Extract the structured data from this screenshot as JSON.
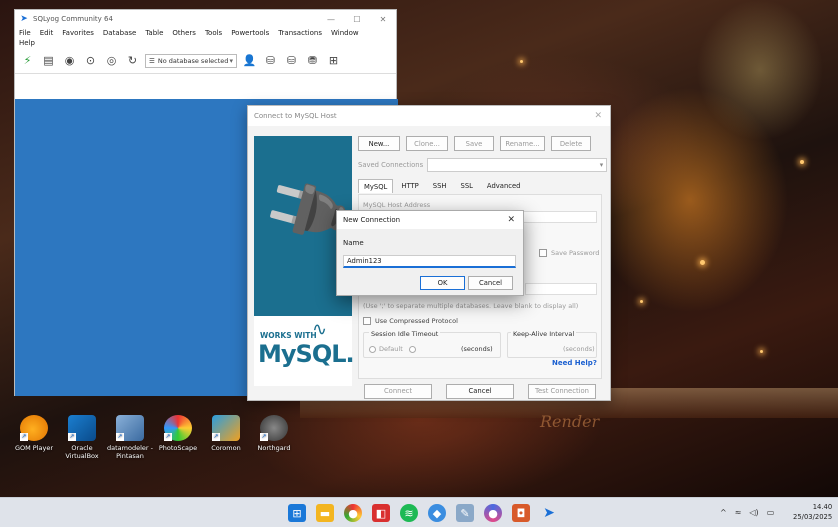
{
  "sqlyog": {
    "title": "SQLyog Community 64",
    "menu": [
      "File",
      "Edit",
      "Favorites",
      "Database",
      "Table",
      "Others",
      "Tools",
      "Powertools",
      "Transactions",
      "Window",
      "Help"
    ],
    "db_select": "No database selected"
  },
  "connect": {
    "title": "Connect to MySQL Host",
    "buttons": {
      "new": "New...",
      "clone": "Clone...",
      "save": "Save",
      "rename": "Rename...",
      "delete": "Delete"
    },
    "saved_connections_label": "Saved Connections",
    "tabs": [
      "MySQL",
      "HTTP",
      "SSH",
      "SSL",
      "Advanced"
    ],
    "mysql_host_label": "MySQL Host Address",
    "save_password_label": "Save Password",
    "databases_hint": "(Use ';' to separate multiple databases. Leave blank to display all)",
    "compressed_label": "Use Compressed Protocol",
    "session_label": "Session Idle Timeout",
    "default_label": "Default",
    "seconds_label": "(seconds)",
    "keepalive_label": "Keep-Alive Interval",
    "keepalive_seconds": "(seconds)",
    "need_help": "Need Help?",
    "connect_btn": "Connect",
    "cancel_btn": "Cancel",
    "test_btn": "Test Connection",
    "brand_works": "WORKS WITH",
    "brand_mysql": "MySQL."
  },
  "newconn": {
    "title": "New Connection",
    "name_label": "Name",
    "name_value": "Admin123",
    "ok": "OK",
    "cancel": "Cancel"
  },
  "desktop_icons": [
    {
      "label": "GOM Player"
    },
    {
      "label": "Oracle VirtualBox"
    },
    {
      "label": "datamodeler - Pintasan"
    },
    {
      "label": "PhotoScape"
    },
    {
      "label": "Coromon"
    },
    {
      "label": "Northgard"
    }
  ],
  "wallpaper_logo": "Render",
  "clock": {
    "time": "14.40",
    "date": "25/03/2025"
  },
  "colors": {
    "accent": "#1a6fd6",
    "sqlyog_client": "#2d77c0",
    "mysql_teal": "#1b6f8f"
  }
}
